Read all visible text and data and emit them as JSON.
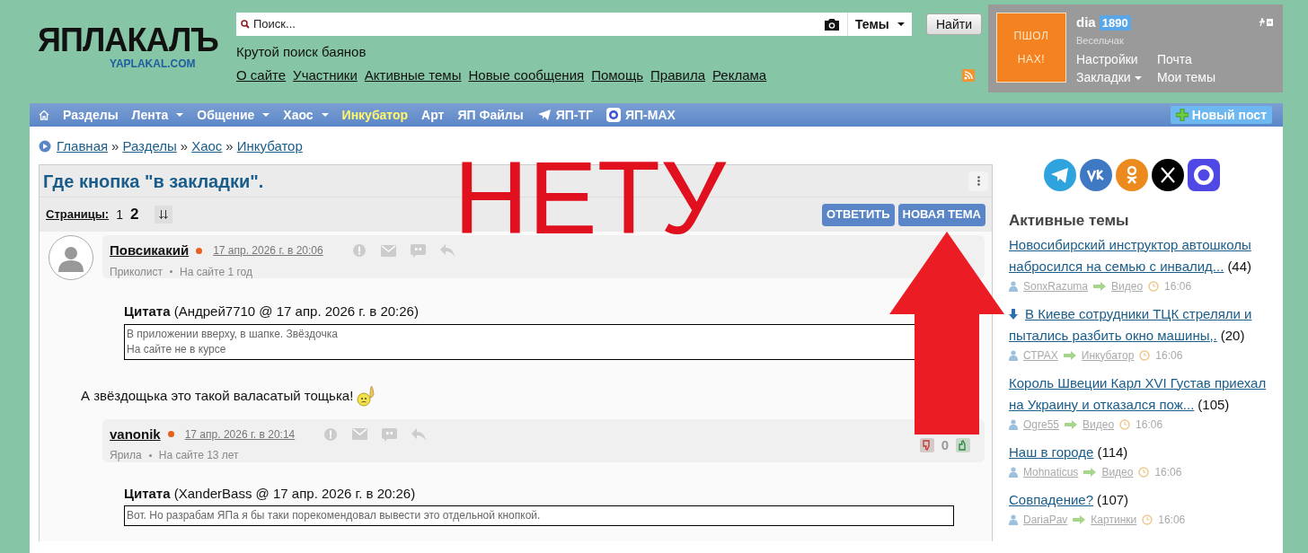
{
  "logo": {
    "title": "ЯПЛАКАЛЪ",
    "domain": "YAPLAKAL.COM"
  },
  "search": {
    "placeholder": "Поиск...",
    "scope": "Темы",
    "button": "Найти"
  },
  "tagline": "Крутой поиск баянов",
  "top_links": [
    "О сайте",
    "Участники",
    "Активные темы",
    "Новые сообщения",
    "Помощь",
    "Правила",
    "Реклама"
  ],
  "user": {
    "avatar_text": "ПШОЛ НАХ!",
    "name": "dia",
    "rating": "1890",
    "rank": "Весельчак",
    "links": [
      {
        "label": "Настройки",
        "dropdown": false
      },
      {
        "label": "Почта",
        "dropdown": false
      },
      {
        "label": "Закладки",
        "dropdown": true
      },
      {
        "label": "Мои темы",
        "dropdown": false
      }
    ]
  },
  "nav": [
    {
      "label": "Разделы",
      "dropdown": false,
      "selected": false
    },
    {
      "label": "Лента",
      "dropdown": true,
      "selected": false
    },
    {
      "label": "Общение",
      "dropdown": true,
      "selected": false
    },
    {
      "label": "Хаос",
      "dropdown": true,
      "selected": false
    },
    {
      "label": "Инкубатор",
      "dropdown": false,
      "selected": true
    },
    {
      "label": "Арт",
      "dropdown": false,
      "selected": false
    },
    {
      "label": "ЯП Файлы",
      "dropdown": false,
      "selected": false
    },
    {
      "label": "ЯП-ТГ",
      "dropdown": false,
      "selected": false
    },
    {
      "label": "ЯП-MAX",
      "dropdown": false,
      "selected": false
    }
  ],
  "new_post": "Новый пост",
  "breadcrumb": [
    {
      "label": "Главная"
    },
    {
      "separator": "»",
      "label": "Разделы"
    },
    {
      "separator": "»",
      "label": "Хаос"
    },
    {
      "separator": "»",
      "label": "Инкубатор"
    }
  ],
  "topic": {
    "title": "Где кнопка \"в закладки\".",
    "pages_label": "Страницы:",
    "pages": [
      {
        "label": "1",
        "selected": false
      },
      {
        "label": "2",
        "selected": true
      }
    ],
    "actions": [
      "ОТВЕТИТЬ",
      "НОВАЯ ТЕМА"
    ]
  },
  "posts": [
    {
      "author": "Повсикакий",
      "online": true,
      "avatar": true,
      "date": "17 апр. 2026 г. в 20:06",
      "rank": "Приколист",
      "since": "На сайте 1 год",
      "body": [
        {
          "kind": "quote",
          "header": "**Цитата** (Андрей7710 @ 17 апр. 2026 г. в 20:26)",
          "lines": [
            "В приложении вверху, в шапке. Звёздочка",
            "На сайте не в курсе"
          ]
        },
        {
          "kind": "text",
          "text": "А звёздощька это такой валасатый тощька!",
          "smiley": true
        }
      ]
    },
    {
      "author": "vanonik",
      "online": true,
      "avatar": false,
      "date": "17 апр. 2026 г. в 20:14",
      "rank": "Ярила",
      "since": "На сайте 13 лет",
      "votes": "0",
      "body": [
        {
          "kind": "quote",
          "header": "**Цитата** (XanderBass @ 17 апр. 2026 г. в 20:26)",
          "lines": [
            "Вот. Но разрабам ЯПа я бы таки порекомендовал вывести это отдельной кнопкой."
          ]
        }
      ]
    }
  ],
  "sidebar": {
    "title": "Активные темы",
    "topics": [
      {
        "title_lines": [
          "Новосибирский инструктор автошколы",
          "набросился на семью с инвалид..."
        ],
        "count": "(44)",
        "pinned": false,
        "author": "SonxRazuma",
        "section": "Видео",
        "time": "16:06"
      },
      {
        "title_lines": [
          "В Киеве сотрудники ТЦК стреляли и",
          "пытались разбить окно машины,."
        ],
        "count": "(20)",
        "pinned": true,
        "author": "СТРАХ",
        "section": "Инкубатор",
        "time": "16:06"
      },
      {
        "title_lines": [
          "Король Швеции Карл XVI Густав приехал",
          "на Украину и отказался пож..."
        ],
        "count": "(105)",
        "pinned": false,
        "author": "Ogre55",
        "section": "Видео",
        "time": "16:06"
      },
      {
        "title_lines": [
          "Наш в городе"
        ],
        "count": "(114)",
        "pinned": false,
        "author": "Mohnaticus",
        "section": "Видео",
        "time": "16:06"
      },
      {
        "title_lines": [
          "Совпадение?"
        ],
        "count": "(107)",
        "pinned": false,
        "author": "DariaPav",
        "section": "Картинки",
        "time": "16:06"
      }
    ]
  },
  "annotation": {
    "text": "НЕТУ"
  }
}
